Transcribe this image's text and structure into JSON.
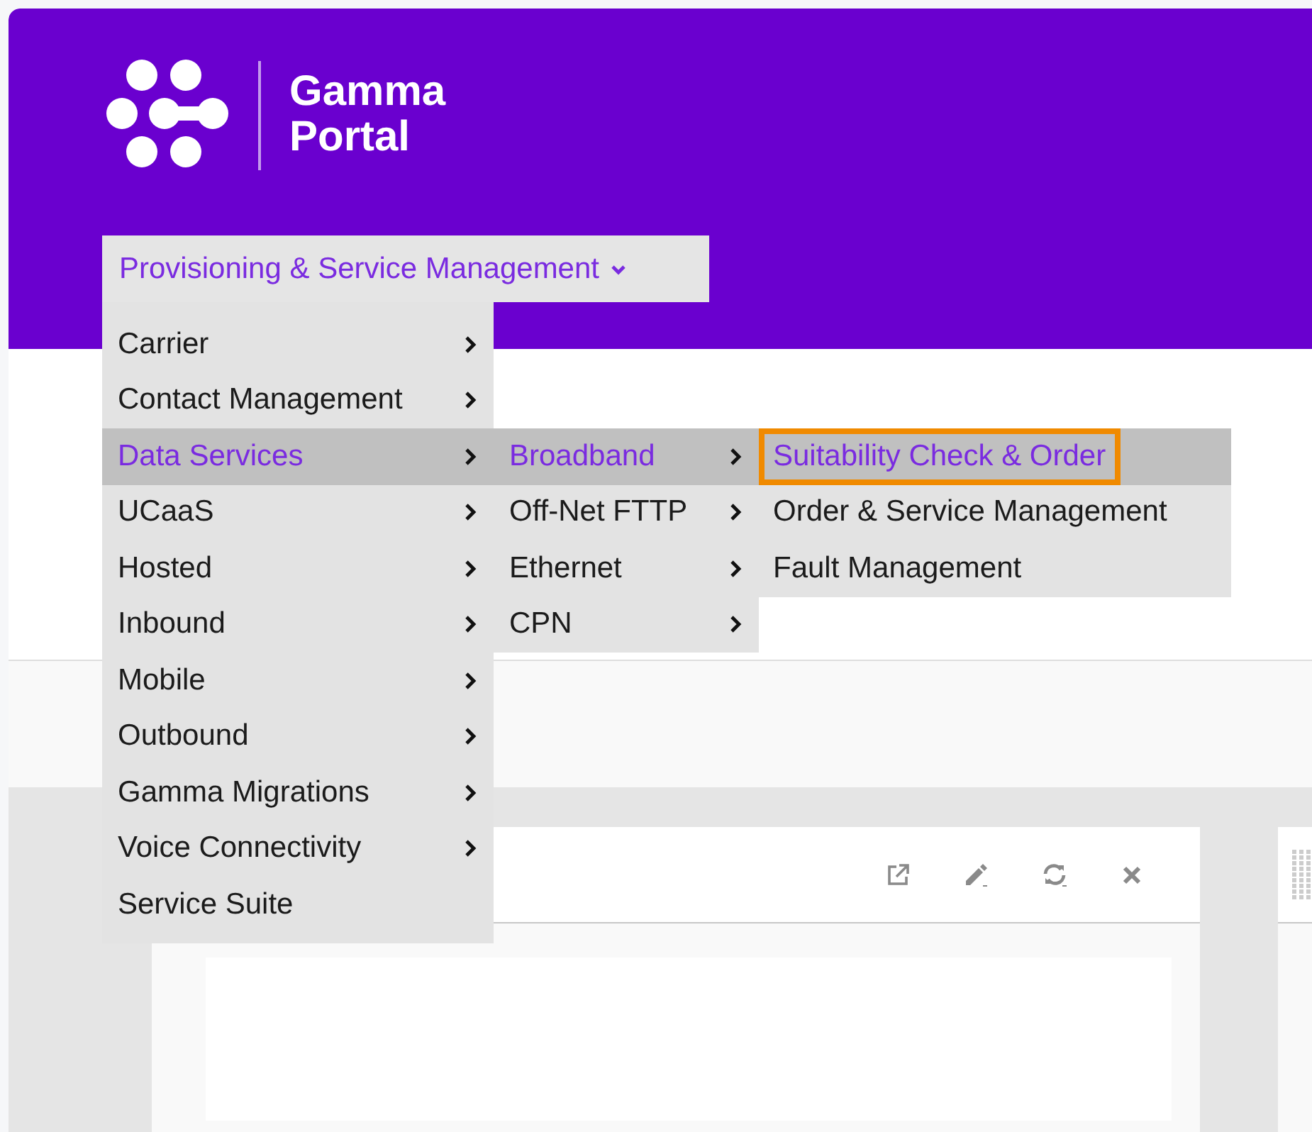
{
  "brand": {
    "line_1": "Gamma",
    "line_2": "Portal"
  },
  "nav": {
    "label": "Provisioning & Service Management",
    "expanded": true,
    "items": [
      {
        "label": "Carrier",
        "selected": false,
        "has_submenu": true
      },
      {
        "label": "Contact Management",
        "selected": false,
        "has_submenu": true
      },
      {
        "label": "Data Services",
        "selected": true,
        "has_submenu": true,
        "children": [
          {
            "label": "Broadband",
            "selected": true,
            "has_submenu": true,
            "children": [
              {
                "label": "Suitability Check & Order",
                "selected": true,
                "focused": true,
                "has_submenu": false
              },
              {
                "label": "Order & Service Management",
                "selected": false,
                "focused": false,
                "has_submenu": false
              },
              {
                "label": "Fault Management",
                "selected": false,
                "focused": false,
                "has_submenu": false
              }
            ]
          },
          {
            "label": "Off-Net FTTP",
            "selected": false,
            "has_submenu": true
          },
          {
            "label": "Ethernet",
            "selected": false,
            "has_submenu": true
          },
          {
            "label": "CPN",
            "selected": false,
            "has_submenu": true
          }
        ]
      },
      {
        "label": "UCaaS",
        "selected": false,
        "has_submenu": true
      },
      {
        "label": "Hosted",
        "selected": false,
        "has_submenu": true
      },
      {
        "label": "Inbound",
        "selected": false,
        "has_submenu": true
      },
      {
        "label": "Mobile",
        "selected": false,
        "has_submenu": true
      },
      {
        "label": "Outbound",
        "selected": false,
        "has_submenu": true
      },
      {
        "label": "Gamma Migrations",
        "selected": false,
        "has_submenu": true
      },
      {
        "label": "Voice Connectivity",
        "selected": false,
        "has_submenu": true
      },
      {
        "label": "Service Suite",
        "selected": false,
        "has_submenu": false
      }
    ]
  }
}
